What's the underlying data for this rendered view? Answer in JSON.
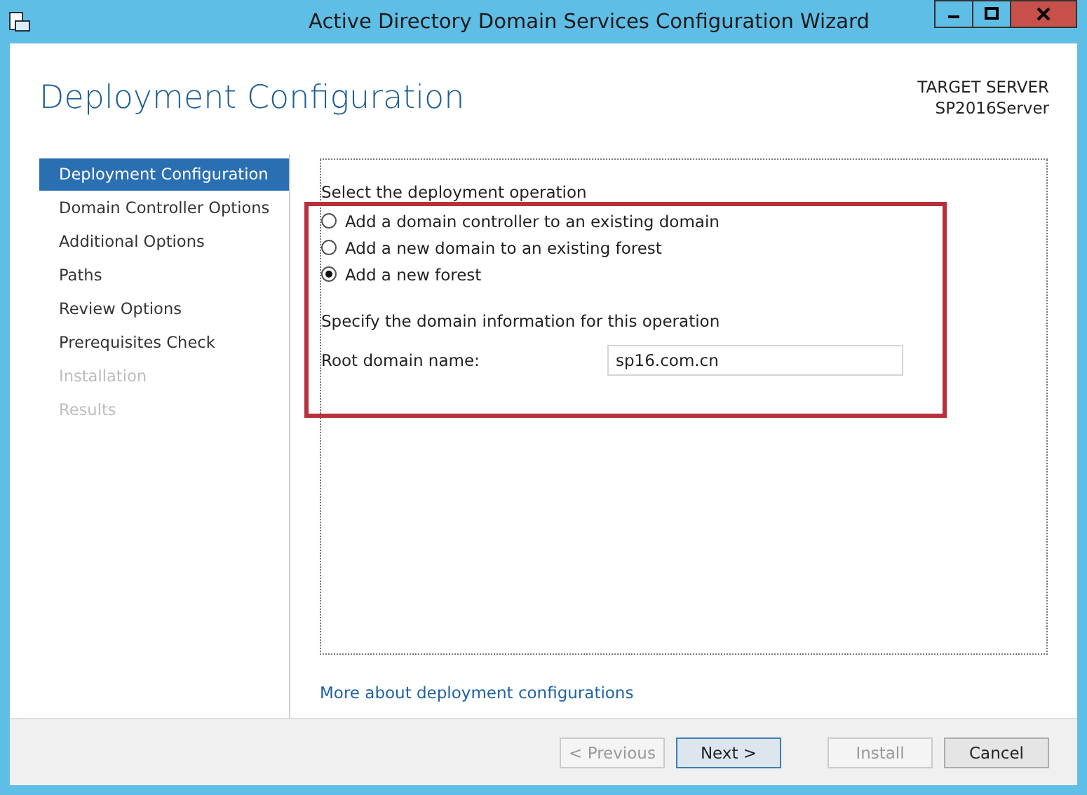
{
  "window": {
    "title": "Active Directory Domain Services Configuration Wizard"
  },
  "header": {
    "title": "Deployment Configuration",
    "server_label": "TARGET SERVER",
    "server_name": "SP2016Server"
  },
  "sidebar": {
    "items": [
      {
        "label": "Deployment Configuration",
        "selected": true,
        "disabled": false
      },
      {
        "label": "Domain Controller Options",
        "selected": false,
        "disabled": false
      },
      {
        "label": "Additional Options",
        "selected": false,
        "disabled": false
      },
      {
        "label": "Paths",
        "selected": false,
        "disabled": false
      },
      {
        "label": "Review Options",
        "selected": false,
        "disabled": false
      },
      {
        "label": "Prerequisites Check",
        "selected": false,
        "disabled": false
      },
      {
        "label": "Installation",
        "selected": false,
        "disabled": true
      },
      {
        "label": "Results",
        "selected": false,
        "disabled": true
      }
    ]
  },
  "main": {
    "heading": "Select the deployment operation",
    "options": [
      {
        "label": "Add a domain controller to an existing domain",
        "selected": false
      },
      {
        "label": "Add a new domain to an existing forest",
        "selected": false
      },
      {
        "label": "Add a new forest",
        "selected": true
      }
    ],
    "subheading": "Specify the domain information for this operation",
    "field": {
      "label": "Root domain name:",
      "value": "sp16.com.cn"
    },
    "link": "More about deployment configurations"
  },
  "buttons": [
    {
      "label": "< Previous",
      "disabled": true,
      "default": false
    },
    {
      "label": "Next >",
      "disabled": false,
      "default": true
    },
    {
      "label": "Install",
      "disabled": true,
      "default": false
    },
    {
      "label": "Cancel",
      "disabled": false,
      "default": false
    }
  ]
}
